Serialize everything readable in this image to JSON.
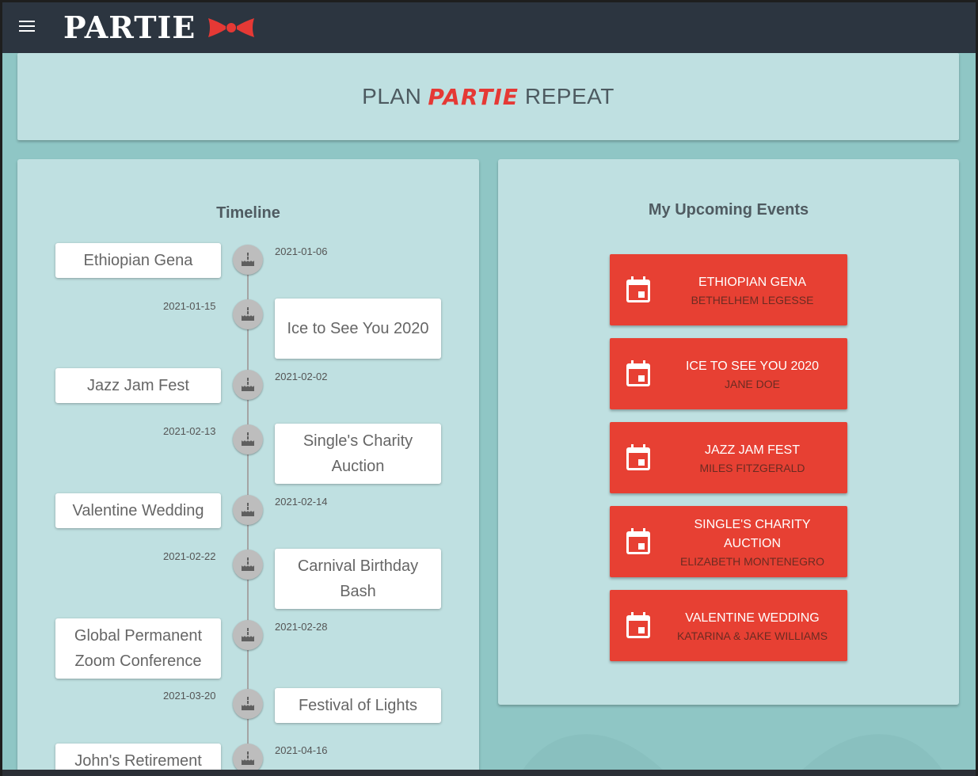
{
  "brand": {
    "name": "PARTIE"
  },
  "hero": {
    "before": "PLAN",
    "accent": "PARTIE",
    "after": "REPEAT"
  },
  "timeline": {
    "title": "Timeline",
    "entries": [
      {
        "name": "Ethiopian Gena",
        "date": "2021-01-06"
      },
      {
        "name": "Ice to See You 2020",
        "date": "2021-01-15"
      },
      {
        "name": "Jazz Jam Fest",
        "date": "2021-02-02"
      },
      {
        "name": "Single's Charity Auction",
        "date": "2021-02-13"
      },
      {
        "name": "Valentine Wedding",
        "date": "2021-02-14"
      },
      {
        "name": "Carnival Birthday Bash",
        "date": "2021-02-22"
      },
      {
        "name": "Global Permanent Zoom Conference",
        "date": "2021-02-28"
      },
      {
        "name": "Festival of Lights",
        "date": "2021-03-20"
      },
      {
        "name": "John's Retirement",
        "date": "2021-04-16"
      }
    ]
  },
  "upcoming": {
    "title": "My Upcoming Events",
    "events": [
      {
        "title": "Ethiopian Gena",
        "host": "Bethelhem Legesse"
      },
      {
        "title": "Ice to See You 2020",
        "host": "Jane Doe"
      },
      {
        "title": "Jazz Jam Fest",
        "host": "Miles Fitzgerald"
      },
      {
        "title": "Single's Charity Auction",
        "host": "Elizabeth Montenegro"
      },
      {
        "title": "Valentine Wedding",
        "host": "Katarina & Jake Williams"
      }
    ]
  },
  "colors": {
    "topbar": "#2c3540",
    "background": "#8fc6c5",
    "card": "#bfe0e1",
    "accent": "#e74033"
  },
  "icons": {
    "menu": "menu-icon",
    "bowtie": "bowtie-logo",
    "timeline_node": "cake-icon",
    "event": "calendar-icon"
  }
}
